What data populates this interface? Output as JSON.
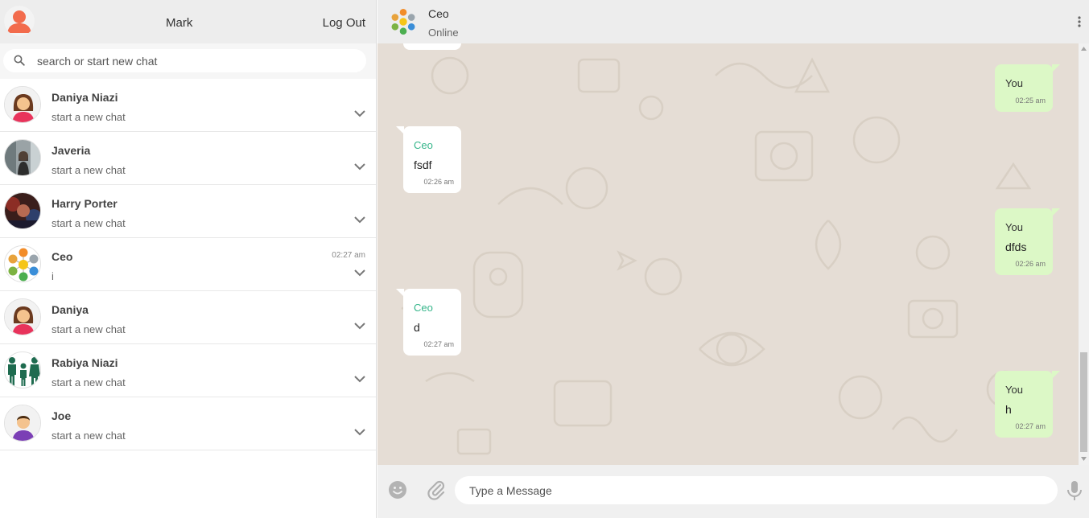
{
  "sidebar": {
    "user_name": "Mark",
    "logout_label": "Log Out",
    "search_placeholder": "search or start new chat",
    "chats": [
      {
        "name": "Daniya Niazi",
        "preview": "start a new chat",
        "time": "",
        "avatar": "woman-avatar"
      },
      {
        "name": "Javeria",
        "preview": "start a new chat",
        "time": "",
        "avatar": "photo-avatar"
      },
      {
        "name": "Harry Porter",
        "preview": "start a new chat",
        "time": "",
        "avatar": "photo-avatar"
      },
      {
        "name": "Ceo",
        "preview": "i",
        "time": "02:27 am",
        "avatar": "group-icons-avatar"
      },
      {
        "name": "Daniya",
        "preview": "start a new chat",
        "time": "",
        "avatar": "woman-avatar"
      },
      {
        "name": "Rabiya Niazi",
        "preview": "start a new chat",
        "time": "",
        "avatar": "family-avatar"
      },
      {
        "name": "Joe",
        "preview": "start a new chat",
        "time": "",
        "avatar": "man-avatar"
      }
    ]
  },
  "conversation": {
    "name": "Ceo",
    "status": "Online",
    "messages": [
      {
        "direction": "out",
        "sender": "You",
        "text": "",
        "time": "02:25 am"
      },
      {
        "direction": "in",
        "sender": "Ceo",
        "text": "fsdf",
        "time": "02:26 am"
      },
      {
        "direction": "out",
        "sender": "You",
        "text": "dfds",
        "time": "02:26 am"
      },
      {
        "direction": "in",
        "sender": "Ceo",
        "text": "d",
        "time": "02:27 am"
      },
      {
        "direction": "out",
        "sender": "You",
        "text": "h",
        "time": "02:27 am"
      }
    ],
    "input_placeholder": "Type a Message"
  },
  "colors": {
    "header_bg": "#ededed",
    "chat_bg": "#e5ddd5",
    "outgoing_bubble": "#dcf8c6",
    "incoming_bubble": "#ffffff",
    "sender_green": "#35b58a",
    "avatar_orange": "#f26b4c"
  },
  "icons": [
    "user-avatar-icon",
    "search-icon",
    "chevron-down-icon",
    "menu-dots-icon",
    "emoji-icon",
    "attach-icon",
    "mic-icon"
  ]
}
